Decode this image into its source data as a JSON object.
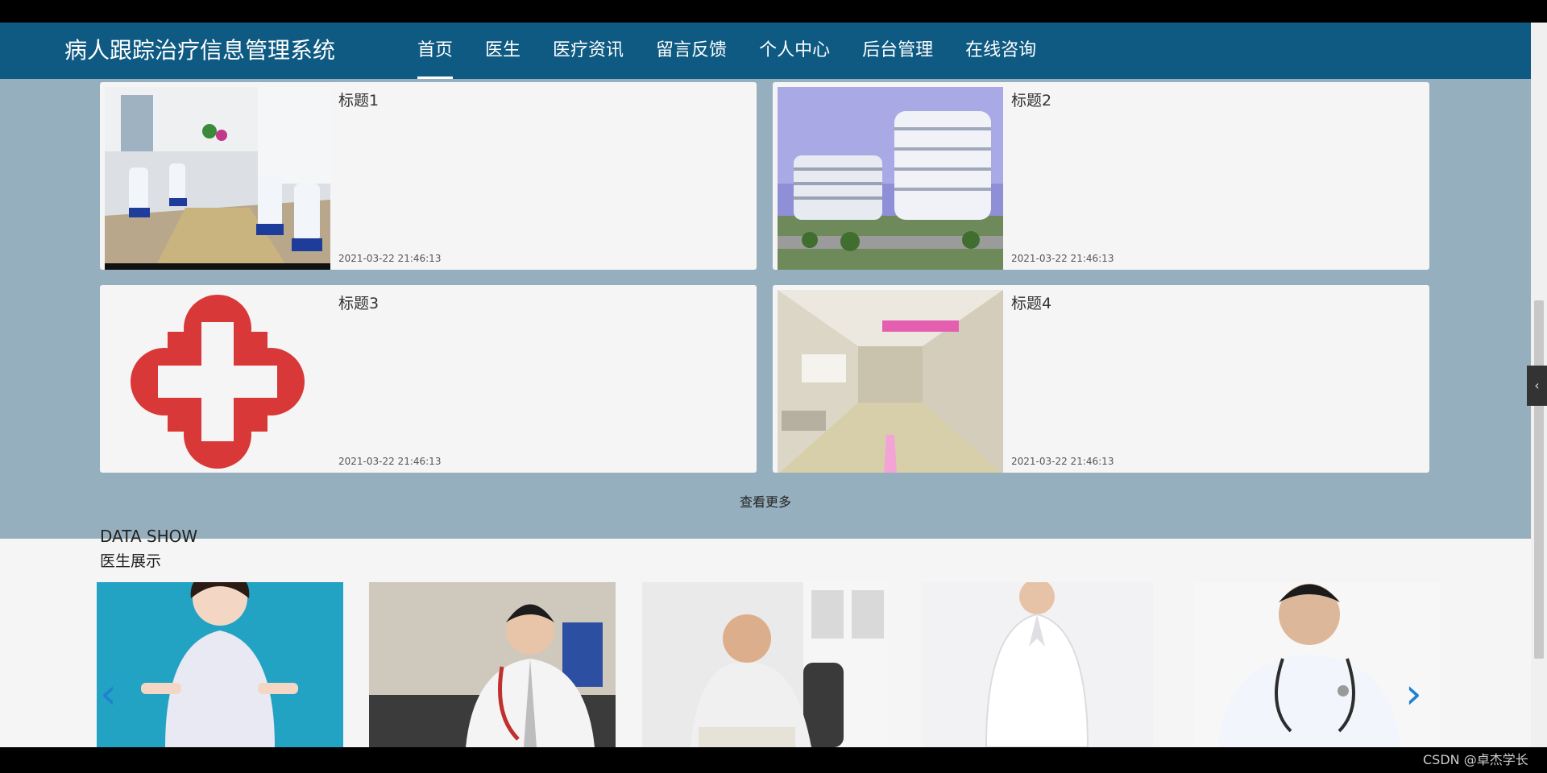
{
  "app": {
    "title": "病人跟踪治疗信息管理系统"
  },
  "nav": {
    "items": [
      {
        "label": "首页",
        "active": true
      },
      {
        "label": "医生"
      },
      {
        "label": "医疗资讯"
      },
      {
        "label": "留言反馈"
      },
      {
        "label": "个人中心"
      },
      {
        "label": "后台管理"
      },
      {
        "label": "在线咨询"
      }
    ]
  },
  "news": {
    "items": [
      {
        "title": "标题1",
        "date": "2021-03-22 21:46:13",
        "image": "infusion-room-photo"
      },
      {
        "title": "标题2",
        "date": "2021-03-22 21:46:13",
        "image": "hospital-building-photo"
      },
      {
        "title": "标题3",
        "date": "2021-03-22 21:46:13",
        "image": "red-cross-logo"
      },
      {
        "title": "标题4",
        "date": "2021-03-22 21:46:13",
        "image": "hospital-corridor-photo"
      }
    ],
    "more_label": "查看更多"
  },
  "doctors": {
    "section_en": "DATA SHOW",
    "section_cn": "医生展示",
    "items": [
      {
        "image": "doctor-photo-1"
      },
      {
        "image": "doctor-photo-2"
      },
      {
        "image": "doctor-photo-3"
      },
      {
        "image": "doctor-photo-4"
      },
      {
        "image": "doctor-photo-5"
      }
    ],
    "prev_icon": "chevron-left-icon",
    "next_icon": "chevron-right-icon"
  },
  "watermark": "CSDN @卓杰学长",
  "colors": {
    "navbar": "#0e5a82",
    "news_bg": "#96afbe",
    "arrow": "#1e82d2",
    "red_cross": "#d93838"
  }
}
